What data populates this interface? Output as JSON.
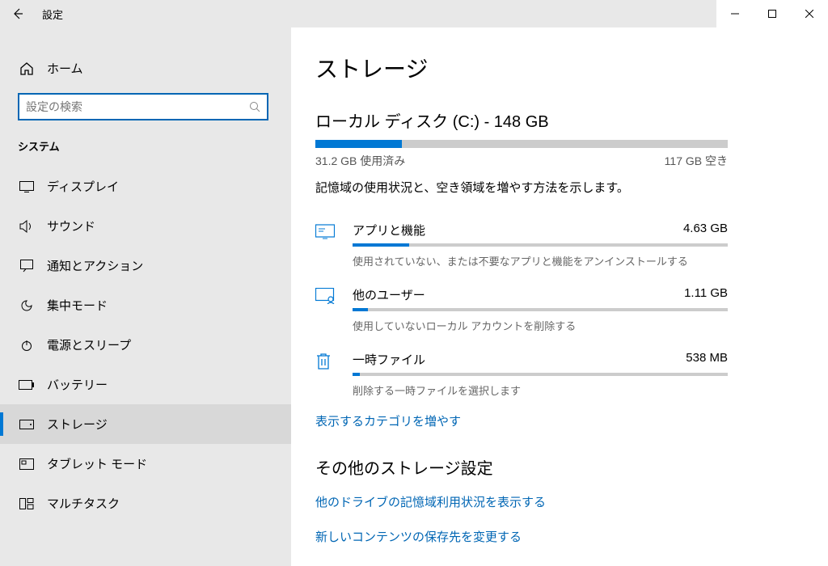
{
  "titlebar": {
    "title": "設定"
  },
  "sidebar": {
    "home": "ホーム",
    "search_placeholder": "設定の検索",
    "section": "システム",
    "items": [
      {
        "label": "ディスプレイ"
      },
      {
        "label": "サウンド"
      },
      {
        "label": "通知とアクション"
      },
      {
        "label": "集中モード"
      },
      {
        "label": "電源とスリープ"
      },
      {
        "label": "バッテリー"
      },
      {
        "label": "ストレージ"
      },
      {
        "label": "タブレット モード"
      },
      {
        "label": "マルチタスク"
      }
    ]
  },
  "main": {
    "title": "ストレージ",
    "disk_title": "ローカル ディスク (C:) - 148 GB",
    "used_label": "31.2 GB 使用済み",
    "free_label": "117 GB 空き",
    "used_pct": "21%",
    "desc": "記憶域の使用状況と、空き領域を増やす方法を示します。",
    "categories": [
      {
        "name": "アプリと機能",
        "size": "4.63 GB",
        "desc": "使用されていない、または不要なアプリと機能をアンインストールする",
        "pct": "15%"
      },
      {
        "name": "他のユーザー",
        "size": "1.11 GB",
        "desc": "使用していないローカル アカウントを削除する",
        "pct": "4%"
      },
      {
        "name": "一時ファイル",
        "size": "538 MB",
        "desc": "削除する一時ファイルを選択します",
        "pct": "2%"
      }
    ],
    "more_link": "表示するカテゴリを増やす",
    "other_title": "その他のストレージ設定",
    "other_links": [
      "他のドライブの記憶域利用状況を表示する",
      "新しいコンテンツの保存先を変更する"
    ]
  }
}
